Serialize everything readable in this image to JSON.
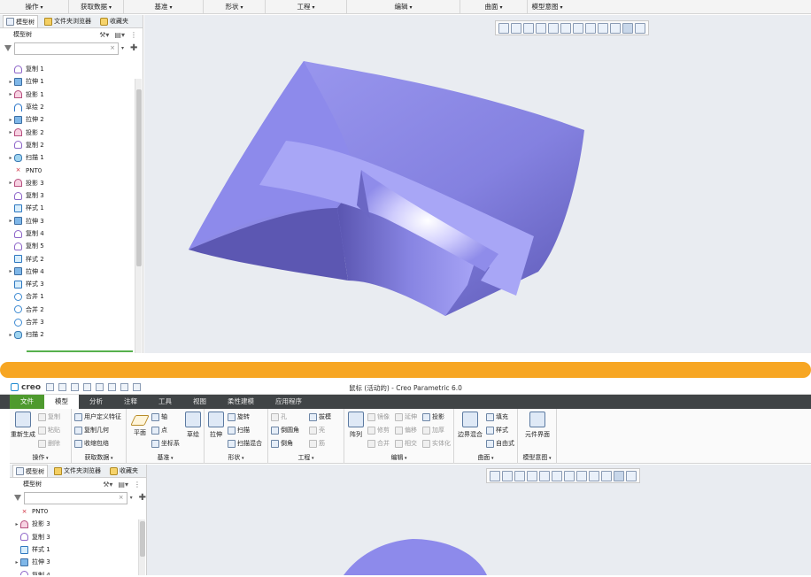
{
  "top": {
    "groups": [
      "操作",
      "获取数据",
      "基准",
      "形状",
      "工程",
      "编辑",
      "曲面",
      "模型意图"
    ],
    "left_panel": {
      "tabs": [
        "模型树",
        "文件夹浏览器",
        "收藏夹"
      ],
      "tree_title": "模型树",
      "filter_clear": "×",
      "tree": [
        {
          "label": "复制 1",
          "type": "copy",
          "expand": false
        },
        {
          "label": "拉伸 1",
          "type": "extrude",
          "expand": true
        },
        {
          "label": "投影 1",
          "type": "proj",
          "expand": true
        },
        {
          "label": "草绘 2",
          "type": "sketch",
          "expand": false
        },
        {
          "label": "拉伸 2",
          "type": "extrude",
          "expand": true
        },
        {
          "label": "投影 2",
          "type": "proj",
          "expand": true
        },
        {
          "label": "复制 2",
          "type": "copy",
          "expand": false
        },
        {
          "label": "扫描 1",
          "type": "sweep",
          "expand": true
        },
        {
          "label": "PNT0",
          "type": "pnt",
          "expand": false
        },
        {
          "label": "投影 3",
          "type": "proj",
          "expand": true
        },
        {
          "label": "复制 3",
          "type": "copy",
          "expand": false
        },
        {
          "label": "样式 1",
          "type": "style",
          "expand": false
        },
        {
          "label": "拉伸 3",
          "type": "extrude",
          "expand": true
        },
        {
          "label": "复制 4",
          "type": "copy",
          "expand": false
        },
        {
          "label": "复制 5",
          "type": "copy",
          "expand": false
        },
        {
          "label": "样式 2",
          "type": "style",
          "expand": false
        },
        {
          "label": "拉伸 4",
          "type": "extrude",
          "expand": true
        },
        {
          "label": "样式 3",
          "type": "style",
          "expand": false
        },
        {
          "label": "合并 1",
          "type": "merge",
          "expand": false
        },
        {
          "label": "合并 2",
          "type": "merge",
          "expand": false
        },
        {
          "label": "合并 3",
          "type": "merge",
          "expand": false
        },
        {
          "label": "扫描 2",
          "type": "sweep",
          "expand": true
        }
      ]
    }
  },
  "bottom": {
    "app_logo": "creo",
    "window_title": "鼠标 (活动的) - Creo Parametric 6.0",
    "ribbon_tabs": [
      "文件",
      "模型",
      "分析",
      "注释",
      "工具",
      "视图",
      "柔性建模",
      "应用程序"
    ],
    "active_tab": "模型",
    "groups": {
      "ops": {
        "label": "操作",
        "regen": "重新生成",
        "copy": "复制",
        "paste": "粘贴",
        "delete": "删除"
      },
      "getdata": {
        "label": "获取数据",
        "udf": "用户定义特征",
        "copygeom": "复制几何",
        "shrinkwrap": "收缩包络"
      },
      "datum": {
        "label": "基准",
        "plane": "平面",
        "axis": "轴",
        "point": "点",
        "csys": "坐标系",
        "sketch": "草绘"
      },
      "shapes": {
        "label": "形状",
        "extrude": "拉伸",
        "revolve": "旋转",
        "sweep": "扫描",
        "sweptblend": "扫描混合"
      },
      "eng": {
        "label": "工程",
        "hole": "孔",
        "round": "倒圆角",
        "chamfer": "倒角",
        "draft": "拔模",
        "shell": "壳",
        "rib": "筋"
      },
      "edit": {
        "label": "编辑",
        "pattern": "阵列",
        "mirror": "镜像",
        "extend": "延伸",
        "project": "投影",
        "trim": "修剪",
        "offset": "偏移",
        "thicken": "加厚",
        "merge": "合并",
        "intersect": "相交",
        "solidify": "实体化"
      },
      "surfaces": {
        "label": "曲面",
        "boundary": "边界混合",
        "fill": "填充",
        "style": "样式",
        "freestyle": "自由式"
      },
      "intent": {
        "label": "模型意图",
        "component": "元件界面"
      }
    },
    "left_panel": {
      "tabs": [
        "模型树",
        "文件夹浏览器",
        "收藏夹"
      ],
      "tree_title": "模型树",
      "filter_clear": "×",
      "tree": [
        {
          "label": "PNT0",
          "type": "pnt",
          "expand": false
        },
        {
          "label": "投影 3",
          "type": "proj",
          "expand": true
        },
        {
          "label": "复制 3",
          "type": "copy",
          "expand": false
        },
        {
          "label": "样式 1",
          "type": "style",
          "expand": false
        },
        {
          "label": "拉伸 3",
          "type": "extrude",
          "expand": true
        },
        {
          "label": "复制 4",
          "type": "copy",
          "expand": false
        }
      ]
    }
  },
  "colors": {
    "accent_orange": "#f7a623",
    "file_tab": "#4e9a2e",
    "ribbon_dark": "#404446",
    "model_surface": "#8b89e8",
    "viewport": "#e9ecf1"
  }
}
